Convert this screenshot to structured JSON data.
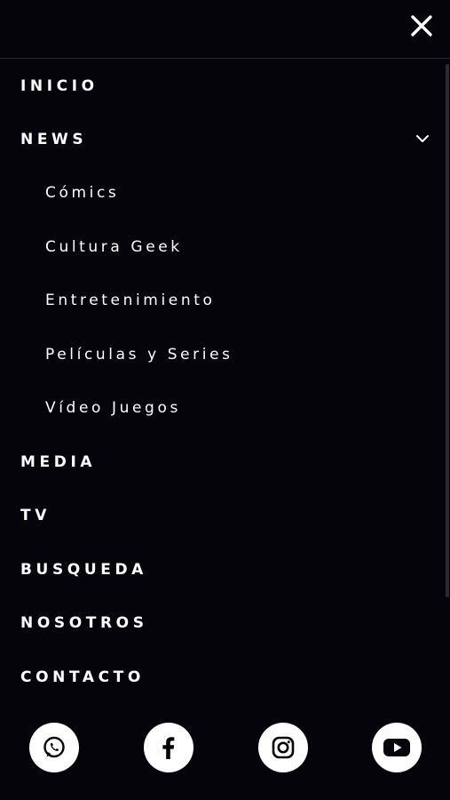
{
  "header": {
    "close_icon": "close-icon"
  },
  "menu": {
    "items": [
      {
        "label": "INICIO"
      },
      {
        "label": "NEWS",
        "expanded": true,
        "icon": "chevron-down-icon"
      },
      {
        "label": "MEDIA"
      },
      {
        "label": "TV"
      },
      {
        "label": "BUSQUEDA"
      },
      {
        "label": "NOSOTROS"
      },
      {
        "label": "CONTACTO"
      }
    ],
    "news_submenu": [
      {
        "label": "Cómics"
      },
      {
        "label": "Cultura Geek"
      },
      {
        "label": "Entretenimiento"
      },
      {
        "label": "Películas y Series"
      },
      {
        "label": "Vídeo Juegos"
      }
    ]
  },
  "social": [
    {
      "icon": "whatsapp-icon"
    },
    {
      "icon": "facebook-icon"
    },
    {
      "icon": "instagram-icon"
    },
    {
      "icon": "youtube-icon"
    }
  ],
  "colors": {
    "background": "#05040a",
    "text": "#ffffff",
    "divider": "#2a2a33"
  }
}
